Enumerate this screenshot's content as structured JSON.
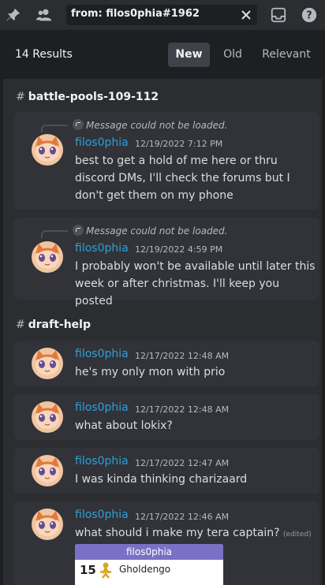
{
  "toolbar": {
    "pin_icon": "pin-icon",
    "members_icon": "members-icon",
    "inbox_icon": "inbox-icon",
    "help_icon": "help-icon"
  },
  "search": {
    "value": "from: filos0phia#1962",
    "clear_icon": "close-icon"
  },
  "results": {
    "count": "14 Results",
    "sort_tabs": [
      "New",
      "Old",
      "Relevant"
    ],
    "active_tab": "New"
  },
  "groups": [
    {
      "channel": "battle-pools-109-112",
      "messages": [
        {
          "reply": "Message could not be loaded.",
          "author": "filos0phia",
          "time": "12/19/2022 7:12 PM",
          "text": "best to get a hold of me here or thru discord DMs, I'll check the forums but I don't get them on my phone"
        },
        {
          "reply": "Message could not be loaded.",
          "author": "filos0phia",
          "time": "12/19/2022 4:59 PM",
          "text": "I probably won't be available until later this week or after christmas. I'll keep you posted"
        }
      ]
    },
    {
      "channel": "draft-help",
      "messages": [
        {
          "author": "filos0phia",
          "time": "12/17/2022 12:48 AM",
          "text": "he's my only mon with prio"
        },
        {
          "author": "filos0phia",
          "time": "12/17/2022 12:48 AM",
          "text": "what about lokix?"
        },
        {
          "author": "filos0phia",
          "time": "12/17/2022 12:47 AM",
          "text": "I was kinda thinking charizaard"
        },
        {
          "author": "filos0phia",
          "time": "12/17/2022 12:46 AM",
          "text": "what should i make my tera captain?",
          "edited": "(edited)",
          "embed": {
            "title": "filos0phia",
            "number": "15",
            "pokemon": "Gholdengo"
          }
        }
      ]
    }
  ],
  "colors": {
    "author": "#2f9fd8",
    "background": "#2b2d31",
    "card": "#313338",
    "embed_header": "#7b70c4"
  }
}
